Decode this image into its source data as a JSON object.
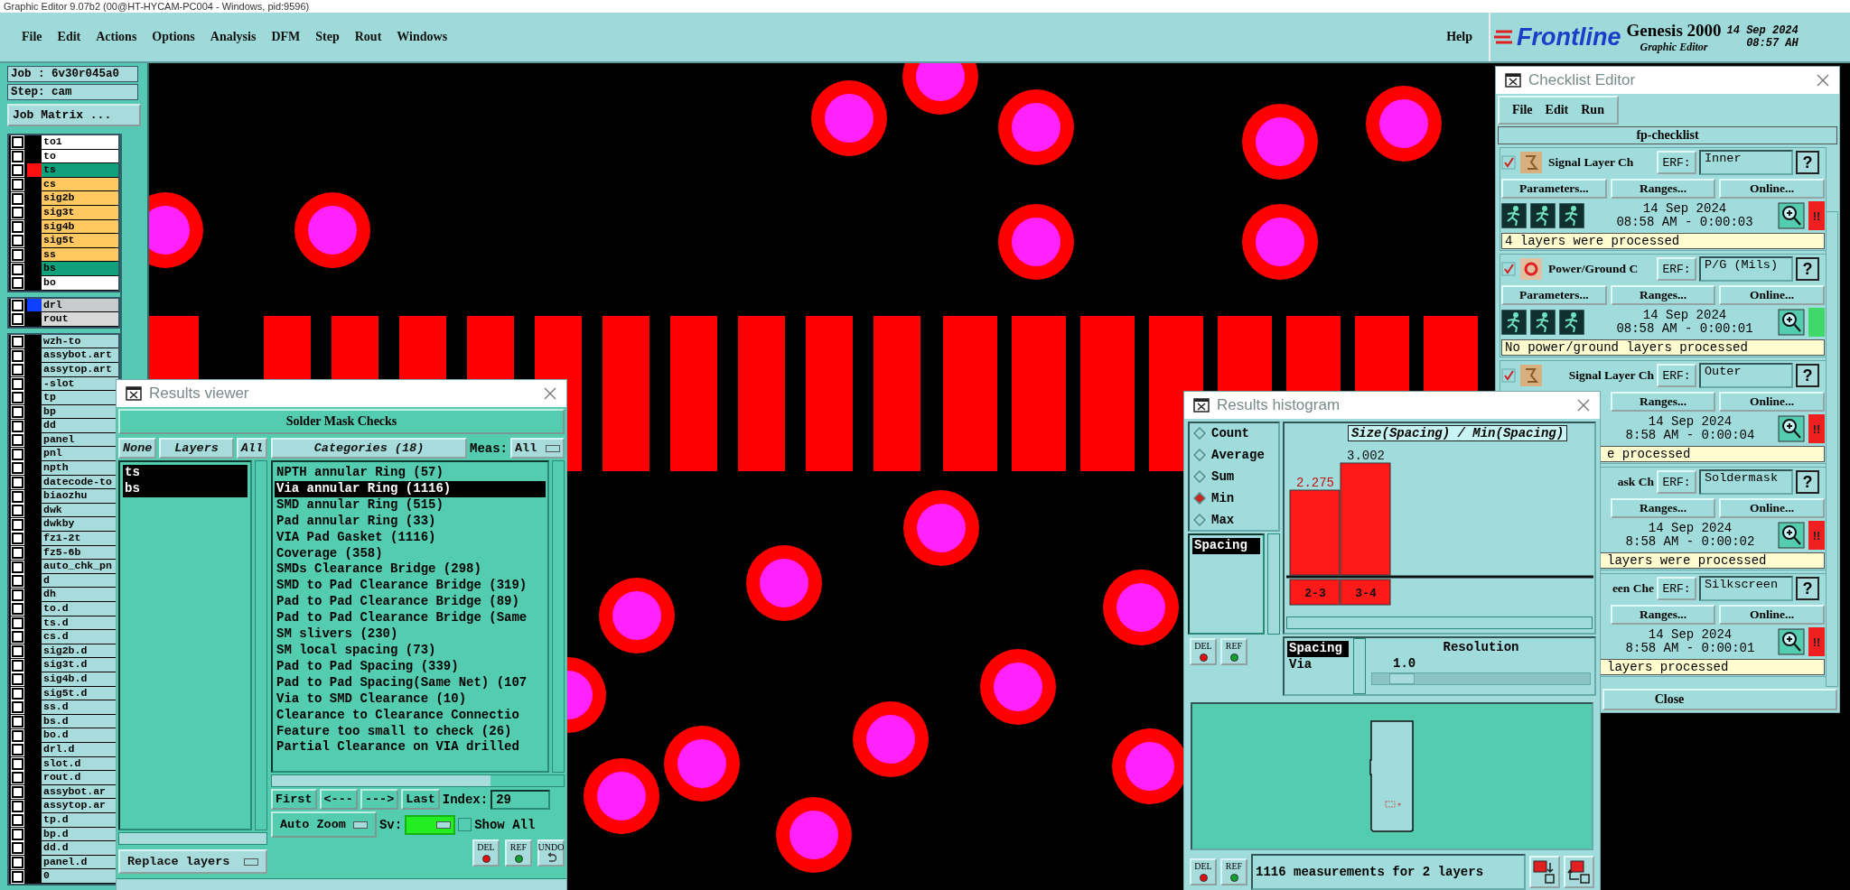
{
  "app_title": "Graphic Editor 9.07b2 (00@HT-HYCAM-PC004 - Windows, pid:9596)",
  "menu": [
    "File",
    "Edit",
    "Actions",
    "Options",
    "Analysis",
    "DFM",
    "Step",
    "Rout",
    "Windows"
  ],
  "help": "Help",
  "brand": {
    "logo": "Frontline",
    "product": "Genesis 2000",
    "subtitle": "Graphic Editor",
    "date": "14 Sep 2024",
    "time": "08:57 AH"
  },
  "job": {
    "job": "Job : 6v30r045a0",
    "step": "Step: cam",
    "matrix_button": "Job Matrix ..."
  },
  "layer_groups": [
    {
      "layers": [
        {
          "name": "to1",
          "color": "#ffffff",
          "checked": false
        },
        {
          "name": "to",
          "color": "#ffffff",
          "checked": false
        },
        {
          "name": "ts",
          "color": "#10a07c",
          "checked": false,
          "marker": {
            "color": "#ff1010"
          }
        },
        {
          "name": "cs",
          "color": "#ffc860",
          "checked": false
        },
        {
          "name": "sig2b",
          "color": "#ffc860",
          "checked": false
        },
        {
          "name": "sig3t",
          "color": "#ffc860",
          "checked": false
        },
        {
          "name": "sig4b",
          "color": "#ffc860",
          "checked": false
        },
        {
          "name": "sig5t",
          "color": "#ffc860",
          "checked": false
        },
        {
          "name": "ss",
          "color": "#ffc860",
          "checked": false
        },
        {
          "name": "bs",
          "color": "#10a07c",
          "checked": false
        },
        {
          "name": "bo",
          "color": "#ffffff",
          "checked": false
        }
      ]
    },
    {
      "layers": [
        {
          "name": "drl",
          "color": "#c8cccc",
          "checked": false,
          "marker": {
            "color": "#1040ff"
          }
        },
        {
          "name": "rout",
          "color": "#d8d8d8",
          "checked": false
        }
      ]
    },
    {
      "layers": [
        {
          "name": "wzh-to",
          "color": "#a8dcdc",
          "checked": false
        },
        {
          "name": "assybot.art",
          "color": "#a8dcdc",
          "checked": false
        },
        {
          "name": "assytop.art",
          "color": "#a8dcdc",
          "checked": false
        },
        {
          "name": "-slot",
          "color": "#a8dcdc",
          "checked": false
        },
        {
          "name": "tp",
          "color": "#a8dcdc",
          "checked": false
        },
        {
          "name": "bp",
          "color": "#a8dcdc",
          "checked": false
        },
        {
          "name": "dd",
          "color": "#a8dcdc",
          "checked": false
        },
        {
          "name": "panel",
          "color": "#a8dcdc",
          "checked": false
        },
        {
          "name": "pnl",
          "color": "#a8dcdc",
          "checked": false
        },
        {
          "name": "npth",
          "color": "#a8dcdc",
          "checked": false
        },
        {
          "name": "datecode-to",
          "color": "#a8dcdc",
          "checked": false
        },
        {
          "name": "biaozhu",
          "color": "#a8dcdc",
          "checked": false
        },
        {
          "name": "dwk",
          "color": "#a8dcdc",
          "checked": false
        },
        {
          "name": "dwkby",
          "color": "#a8dcdc",
          "checked": false
        },
        {
          "name": "fz1-2t",
          "color": "#a8dcdc",
          "checked": false
        },
        {
          "name": "fz5-6b",
          "color": "#a8dcdc",
          "checked": false
        },
        {
          "name": "auto_chk_pn",
          "color": "#a8dcdc",
          "checked": false
        },
        {
          "name": "d",
          "color": "#a8dcdc",
          "checked": false
        },
        {
          "name": "dh",
          "color": "#a8dcdc",
          "checked": false
        },
        {
          "name": "to.d",
          "color": "#a8dcdc",
          "checked": false
        },
        {
          "name": "ts.d",
          "color": "#a8dcdc",
          "checked": false
        },
        {
          "name": "cs.d",
          "color": "#a8dcdc",
          "checked": false
        },
        {
          "name": "sig2b.d",
          "color": "#a8dcdc",
          "checked": false
        },
        {
          "name": "sig3t.d",
          "color": "#a8dcdc",
          "checked": false
        },
        {
          "name": "sig4b.d",
          "color": "#a8dcdc",
          "checked": false
        },
        {
          "name": "sig5t.d",
          "color": "#a8dcdc",
          "checked": false
        },
        {
          "name": "ss.d",
          "color": "#a8dcdc",
          "checked": false
        },
        {
          "name": "bs.d",
          "color": "#a8dcdc",
          "checked": false
        },
        {
          "name": "bo.d",
          "color": "#a8dcdc",
          "checked": false
        },
        {
          "name": "drl.d",
          "color": "#a8dcdc",
          "checked": false
        },
        {
          "name": "slot.d",
          "color": "#a8dcdc",
          "checked": false
        },
        {
          "name": "rout.d",
          "color": "#a8dcdc",
          "checked": false
        },
        {
          "name": "assybot.ar",
          "color": "#a8dcdc",
          "checked": false
        },
        {
          "name": "assytop.ar",
          "color": "#a8dcdc",
          "checked": false
        },
        {
          "name": "tp.d",
          "color": "#a8dcdc",
          "checked": false
        },
        {
          "name": "bp.d",
          "color": "#a8dcdc",
          "checked": false
        },
        {
          "name": "dd.d",
          "color": "#a8dcdc",
          "checked": false
        },
        {
          "name": "panel.d",
          "color": "#a8dcdc",
          "checked": false
        },
        {
          "name": "0",
          "color": "#a8dcdc",
          "checked": false
        }
      ]
    }
  ],
  "results_viewer": {
    "title": "Results viewer",
    "heading": "Solder Mask Checks",
    "layer_buttons": [
      "None",
      "Layers",
      "All"
    ],
    "layers": [
      {
        "name": "ts",
        "selected": true
      },
      {
        "name": "bs",
        "selected": true
      }
    ],
    "categories_button": "Categories (18)",
    "meas_label": "Meas:",
    "meas_value": "All",
    "categories": [
      {
        "label": "NPTH annular Ring (57)",
        "selected": false
      },
      {
        "label": "Via annular Ring (1116)",
        "selected": true
      },
      {
        "label": "SMD annular Ring (515)",
        "selected": false
      },
      {
        "label": "Pad annular Ring (33)",
        "selected": false
      },
      {
        "label": "VIA Pad Gasket (1116)",
        "selected": false
      },
      {
        "label": "Coverage (358)",
        "selected": false
      },
      {
        "label": "SMDs Clearance Bridge (298)",
        "selected": false
      },
      {
        "label": "SMD to Pad Clearance Bridge (319)",
        "selected": false
      },
      {
        "label": "Pad to Pad Clearance Bridge (89)",
        "selected": false
      },
      {
        "label": "Pad to Pad Clearance Bridge (Same",
        "selected": false
      },
      {
        "label": "SM slivers (230)",
        "selected": false
      },
      {
        "label": "SM local spacing (73)",
        "selected": false
      },
      {
        "label": "Pad to Pad Spacing (339)",
        "selected": false
      },
      {
        "label": "Pad to Pad Spacing(Same Net) (107",
        "selected": false
      },
      {
        "label": "Via to SMD Clearance (10)",
        "selected": false
      },
      {
        "label": "Clearance to Clearance Connectio",
        "selected": false
      },
      {
        "label": "Feature too small to check (26)",
        "selected": false
      },
      {
        "label": "Partial Clearance on VIA drilled",
        "selected": false
      }
    ],
    "nav": [
      "First",
      "<---",
      "--->",
      "Last"
    ],
    "index_label": "Index:",
    "index_value": "29",
    "zoom_mode": "Auto Zoom",
    "sv_label": "Sv:",
    "sv": {
      "color": "#22ee22"
    },
    "show_all": {
      "label": "Show All",
      "checked": false
    },
    "replace": "Replace layers",
    "actions": [
      {
        "label": "DEL",
        "kind": "delete"
      },
      {
        "label": "REF",
        "kind": "refresh"
      },
      {
        "label": "UNDO",
        "kind": "undo"
      }
    ]
  },
  "histogram": {
    "title": "Results histogram",
    "modes": [
      {
        "label": "Count",
        "selected": false
      },
      {
        "label": "Average",
        "selected": false
      },
      {
        "label": "Sum",
        "selected": false
      },
      {
        "label": "Min",
        "selected": true
      },
      {
        "label": "Max",
        "selected": false
      }
    ],
    "measures": [
      {
        "label": "Spacing",
        "selected": true
      }
    ],
    "side_actions": [
      {
        "label": "DEL",
        "kind": "delete"
      },
      {
        "label": "REF",
        "kind": "refresh"
      }
    ],
    "chart_data": {
      "type": "bar",
      "title": "Size(Spacing) / Min(Spacing)",
      "categories": [
        "2-3",
        "3-4"
      ],
      "values": [
        2.275,
        3.002
      ],
      "data_labels": true
    },
    "value_list": [
      {
        "label": "Spacing",
        "selected": true
      },
      {
        "label": "Via",
        "selected": false
      }
    ],
    "resolution_label": "Resolution",
    "resolution_value": "1.0",
    "resolution": {
      "level": 0.08
    },
    "bottom_actions": [
      {
        "label": "DEL",
        "kind": "delete"
      },
      {
        "label": "REF",
        "kind": "refresh"
      }
    ],
    "summary": "1116 measurements for 2 layers"
  },
  "checklist": {
    "title": "Checklist Editor",
    "menu": [
      "File",
      "Edit",
      "Run"
    ],
    "name": "fp-checklist",
    "close": "Close",
    "entries": [
      {
        "covered": false,
        "checked": true,
        "kind": "signal",
        "name": "Signal Layer Ch",
        "erf_label": "ERF:",
        "erf": "Inner",
        "help": "?",
        "buttons": [
          "Parameters...",
          "Ranges...",
          "Online..."
        ],
        "date": "14 Sep 2024",
        "time": "08:58 AM - 0:00:03",
        "color": "#f02020",
        "flag": "!!",
        "status": "4 layers were processed"
      },
      {
        "covered": false,
        "checked": true,
        "kind": "power",
        "name": "Power/Ground C",
        "erf_label": "ERF:",
        "erf": "P/G (Mils)",
        "help": "?",
        "buttons": [
          "Parameters...",
          "Ranges...",
          "Online..."
        ],
        "date": "14 Sep 2024",
        "time": "08:58 AM - 0:00:01",
        "color": "#40d868",
        "status": "No power/ground layers processed"
      },
      {
        "covered": true,
        "checked": true,
        "kind": "signal",
        "name": "Signal Layer Ch",
        "erf_label": "ERF:",
        "erf": "Outer",
        "help": "?",
        "buttons": [
          "Ranges...",
          "Online..."
        ],
        "date": "14 Sep 2024",
        "time": "8:58 AM - 0:00:04",
        "color": "#f02020",
        "flag": "!!",
        "status": "e processed"
      },
      {
        "covered": true,
        "kind": "none",
        "name": "ask Ch",
        "erf_label": "ERF:",
        "erf": "Soldermask",
        "help": "?",
        "buttons": [
          "Ranges...",
          "Online..."
        ],
        "date": "14 Sep 2024",
        "time": "8:58 AM - 0:00:02",
        "color": "#f02020",
        "flag": "!!",
        "status": "layers were processed"
      },
      {
        "covered": true,
        "kind": "none",
        "name": "een Che",
        "erf_label": "ERF:",
        "erf": "Silkscreen",
        "help": "?",
        "buttons": [
          "Ranges...",
          "Online..."
        ],
        "date": "14 Sep 2024",
        "time": "8:58 AM - 0:00:01",
        "color": "#f02020",
        "flag": "!!",
        "status": "layers processed"
      }
    ]
  }
}
